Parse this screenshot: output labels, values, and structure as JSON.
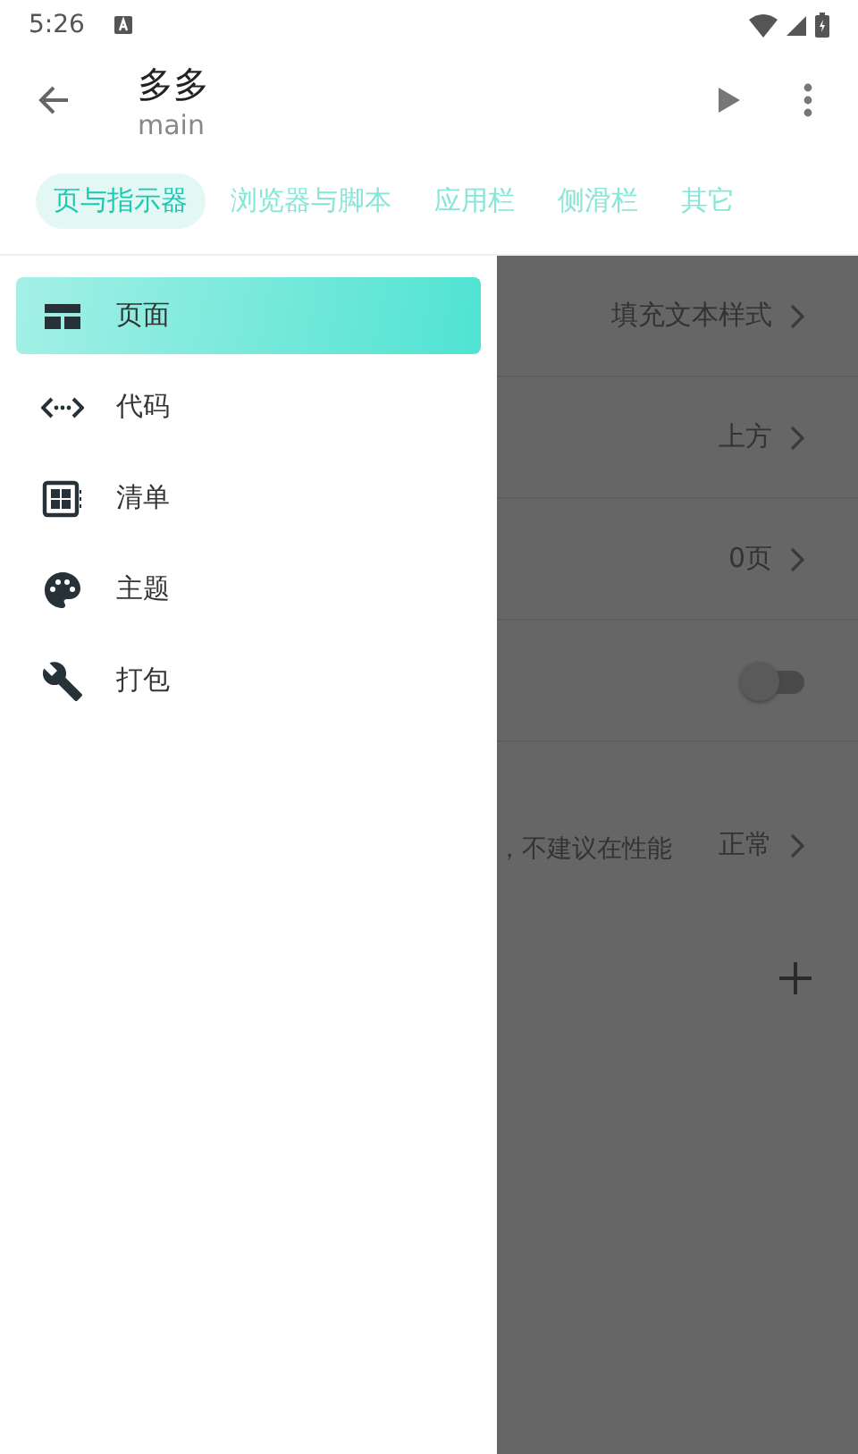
{
  "status_bar": {
    "time": "5:26"
  },
  "app_bar": {
    "title": "多多",
    "subtitle": "main"
  },
  "tabs": [
    {
      "label": "页与指示器",
      "selected": true
    },
    {
      "label": "浏览器与脚本",
      "selected": false
    },
    {
      "label": "应用栏",
      "selected": false
    },
    {
      "label": "侧滑栏",
      "selected": false
    },
    {
      "label": "其它",
      "selected": false
    }
  ],
  "drawer": {
    "items": [
      {
        "label": "页面",
        "kind": "page",
        "selected": true
      },
      {
        "label": "代码",
        "kind": "code",
        "selected": false
      },
      {
        "label": "清单",
        "kind": "manifest",
        "selected": false
      },
      {
        "label": "主题",
        "kind": "theme",
        "selected": false
      },
      {
        "label": "打包",
        "kind": "build",
        "selected": false
      }
    ]
  },
  "settings": [
    {
      "kind": "value",
      "value": "填充文本样式"
    },
    {
      "kind": "value",
      "value": "上方"
    },
    {
      "kind": "value",
      "value": "0页"
    },
    {
      "kind": "toggle",
      "on": false
    },
    {
      "kind": "value",
      "description": "，不建议在性能",
      "value": "正常"
    }
  ]
}
